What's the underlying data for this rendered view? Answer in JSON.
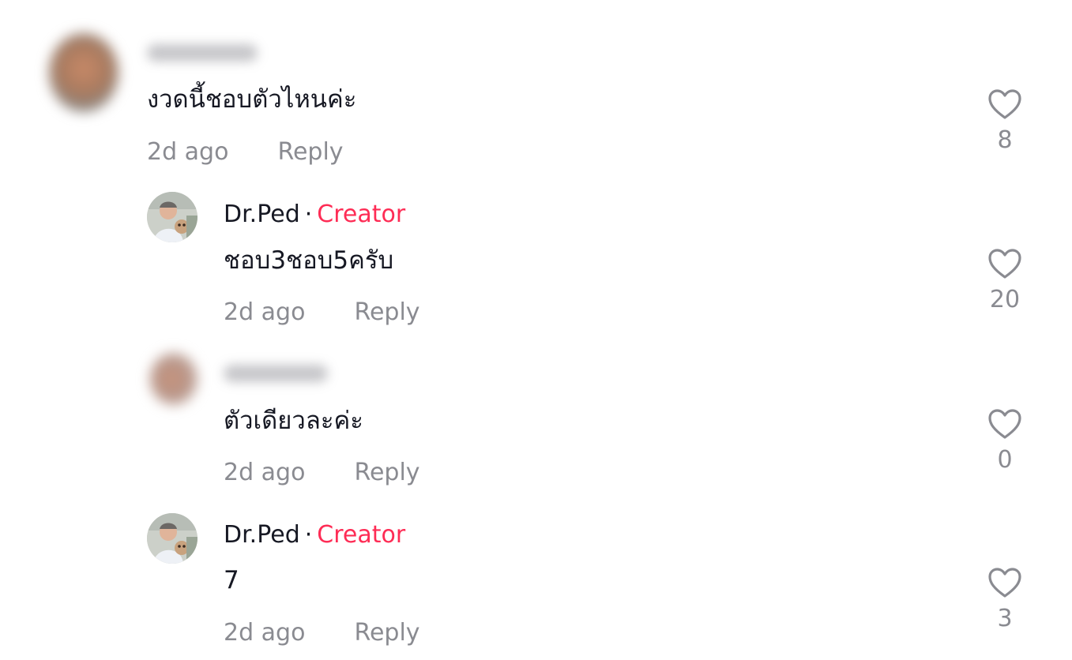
{
  "comments": [
    {
      "text": "งวดนี้ชอบตัวไหนค่ะ",
      "time": "2d ago",
      "reply_label": "Reply",
      "likes": "8"
    },
    {
      "author": "Dr.Ped",
      "separator": "·",
      "badge": "Creator",
      "text": "ชอบ3ชอบ5ครับ",
      "time": "2d ago",
      "reply_label": "Reply",
      "likes": "20"
    },
    {
      "text": "ตัวเดียวละค่ะ",
      "time": "2d ago",
      "reply_label": "Reply",
      "likes": "0"
    },
    {
      "author": "Dr.Ped",
      "separator": "·",
      "badge": "Creator",
      "text": "7",
      "time": "2d ago",
      "reply_label": "Reply",
      "likes": "3"
    }
  ],
  "colors": {
    "creator_badge": "#fe2c55",
    "muted_text": "#8a8b91",
    "primary_text": "#161823"
  },
  "icons": {
    "like": "heart-outline-icon"
  }
}
